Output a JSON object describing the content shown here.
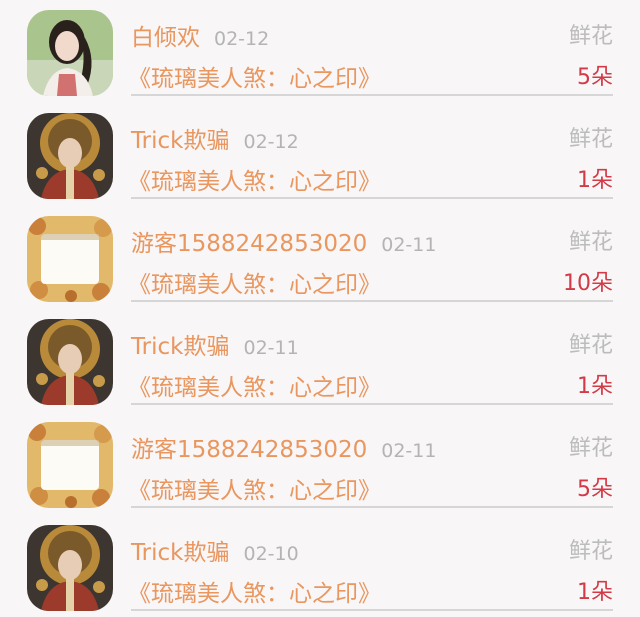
{
  "records": [
    {
      "user": "白倾欢",
      "date": "02-12",
      "gift": "鲜花",
      "book": "《琉璃美人煞：心之印》",
      "count": "5朵",
      "avatar": "girl-photo-icon"
    },
    {
      "user": "Trick欺骗",
      "date": "02-12",
      "gift": "鲜花",
      "book": "《琉璃美人煞：心之印》",
      "count": "1朵",
      "avatar": "painted-lady-icon"
    },
    {
      "user": "游客1588242853020",
      "date": "02-11",
      "gift": "鲜花",
      "book": "《琉璃美人煞：心之印》",
      "count": "10朵",
      "avatar": "floral-frame-icon"
    },
    {
      "user": "Trick欺骗",
      "date": "02-11",
      "gift": "鲜花",
      "book": "《琉璃美人煞：心之印》",
      "count": "1朵",
      "avatar": "painted-lady-icon"
    },
    {
      "user": "游客1588242853020",
      "date": "02-11",
      "gift": "鲜花",
      "book": "《琉璃美人煞：心之印》",
      "count": "5朵",
      "avatar": "floral-frame-icon"
    },
    {
      "user": "Trick欺骗",
      "date": "02-10",
      "gift": "鲜花",
      "book": "《琉璃美人煞：心之印》",
      "count": "1朵",
      "avatar": "painted-lady-icon"
    }
  ]
}
